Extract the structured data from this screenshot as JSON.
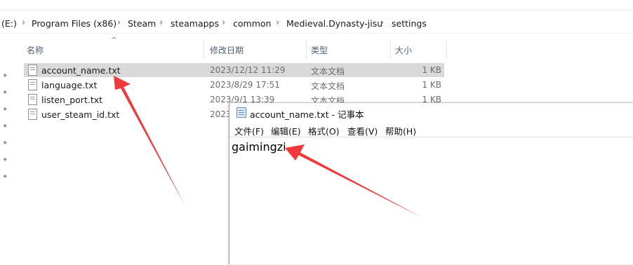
{
  "breadcrumb": {
    "items": [
      "(E:)",
      "Program Files (x86)",
      "Steam",
      "steamapps",
      "common",
      "Medieval.Dynasty-jisu",
      "settings"
    ],
    "separator": "›"
  },
  "columns": {
    "name": "名称",
    "modified": "修改日期",
    "type": "类型",
    "size": "大小"
  },
  "files": [
    {
      "name": "account_name.txt",
      "modified": "2023/12/12 11:29",
      "type": "文本文档",
      "size": "1 KB",
      "state": "highlighted"
    },
    {
      "name": "language.txt",
      "modified": "2023/8/29 17:51",
      "type": "文本文档",
      "size": "1 KB",
      "state": "normal"
    },
    {
      "name": "listen_port.txt",
      "modified": "2023/9/1 13:39",
      "type": "文本文档",
      "size": "1 KB",
      "state": "normal"
    },
    {
      "name": "user_steam_id.txt",
      "modified": "2023",
      "type": "",
      "size": "",
      "state": "normal"
    }
  ],
  "notepad": {
    "title": "account_name.txt - 记事本",
    "menu": [
      "文件(F)",
      "编辑(E)",
      "格式(O)",
      "查看(V)",
      "帮助(H)"
    ],
    "content": "gaimingzi"
  },
  "colors": {
    "arrow": "#ee3a3a",
    "row_highlight": "#d9d9d9",
    "header_text": "#4c607a"
  },
  "icons": {
    "file": "text-file-icon",
    "pin": "pin-icon",
    "notepad": "notepad-icon"
  }
}
